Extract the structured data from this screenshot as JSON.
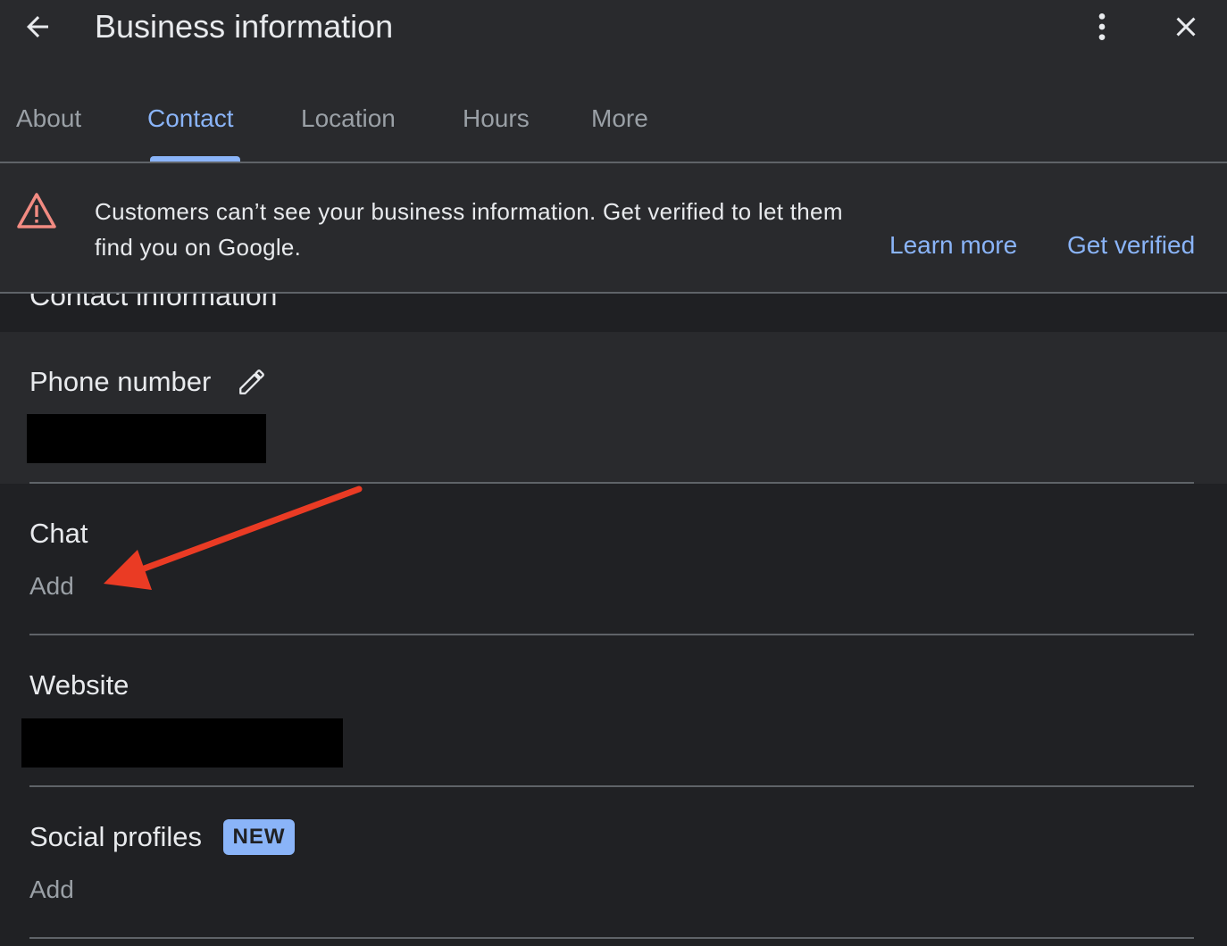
{
  "header": {
    "title": "Business information",
    "back_icon": "arrow-left-icon",
    "menu_icon": "more-vert-icon",
    "close_icon": "close-icon"
  },
  "tabs": [
    {
      "label": "About",
      "active": false
    },
    {
      "label": "Contact",
      "active": true
    },
    {
      "label": "Location",
      "active": false
    },
    {
      "label": "Hours",
      "active": false
    },
    {
      "label": "More",
      "active": false
    }
  ],
  "banner": {
    "message": "Customers can’t see your business information. Get verified to let them find you on Google.",
    "learn_more": "Learn more",
    "get_verified": "Get verified",
    "icon": "warning-icon"
  },
  "section": {
    "heading": "Contact information"
  },
  "fields": {
    "phone": {
      "label": "Phone number"
    },
    "chat": {
      "label": "Chat",
      "add_label": "Add"
    },
    "website": {
      "label": "Website"
    },
    "social": {
      "label": "Social profiles",
      "badge": "NEW",
      "add_label": "Add"
    }
  },
  "colors": {
    "accent": "#8ab4f8",
    "warning": "#f28b82",
    "annotation_arrow": "#ea3b24",
    "background": "#202124",
    "surface": "#292a2d"
  }
}
